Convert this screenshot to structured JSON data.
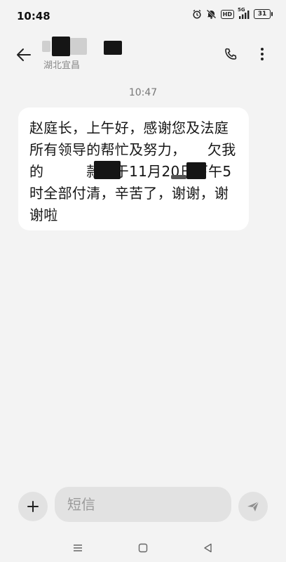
{
  "status_bar": {
    "time": "10:48",
    "hd_label": "HD",
    "network_label": "5G",
    "battery_level": "31"
  },
  "header": {
    "contact_region": "湖北宜昌",
    "back_icon": "arrow-left-icon",
    "call_icon": "phone-icon",
    "more_icon": "more-vertical-icon"
  },
  "conversation": {
    "timestamp": "10:47",
    "message": {
      "text": "赵庭长，上午好，感谢您及法庭所有领导的帮忙及努力，　　欠我的　　　款已于11月20日下午5时全部付清，辛苦了，谢谢，谢谢啦"
    }
  },
  "composer": {
    "placeholder": "短信",
    "add_icon": "plus-icon",
    "send_icon": "send-icon"
  },
  "nav_bar": {
    "menu_icon": "recents-icon",
    "home_icon": "home-icon",
    "back_icon": "back-triangle-icon"
  }
}
